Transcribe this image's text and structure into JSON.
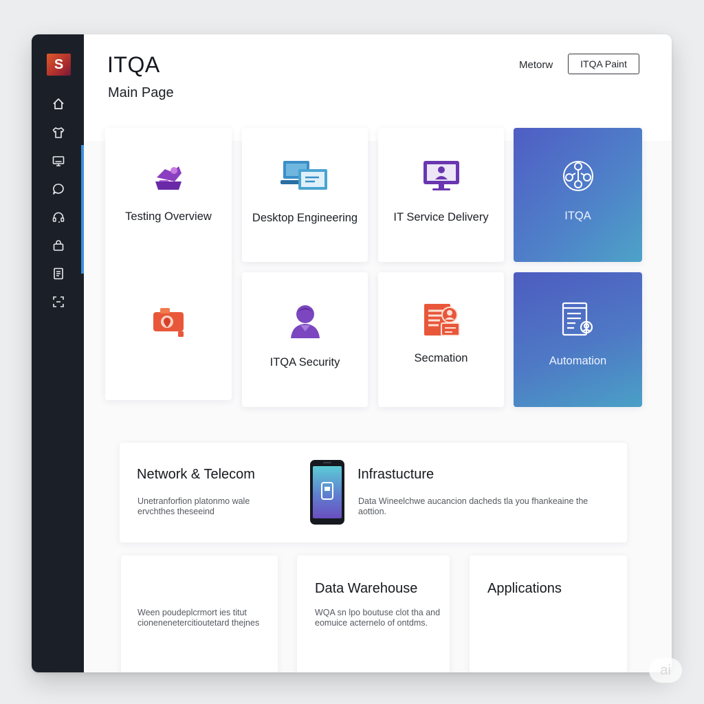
{
  "sidebar": {
    "logo_text": "S",
    "items": [
      {
        "icon": "home-icon"
      },
      {
        "icon": "shirt-icon"
      },
      {
        "icon": "monitor-icon"
      },
      {
        "icon": "chat-icon"
      },
      {
        "icon": "headset-icon"
      },
      {
        "icon": "bag-icon"
      },
      {
        "icon": "document-icon"
      },
      {
        "icon": "scan-icon"
      }
    ]
  },
  "header": {
    "title": "ITQA",
    "subtitle": "Main Page",
    "link_label": "Metorw",
    "button_label": "ITQA Paint"
  },
  "tiles": [
    {
      "label": "Testing Overview",
      "icon": "handshake-icon"
    },
    {
      "label": "Desktop Engineering",
      "icon": "desktops-icon"
    },
    {
      "label": "IT Service Delivery",
      "icon": "monitor-user-icon"
    },
    {
      "label": "ITQA",
      "icon": "team-network-icon"
    },
    {
      "label": "",
      "icon": "camera-location-icon"
    },
    {
      "label": "ITQA Security",
      "icon": "user-icon"
    },
    {
      "label": "Secmation",
      "icon": "form-user-icon"
    },
    {
      "label": "Automation",
      "icon": "report-user-icon"
    }
  ],
  "cards": {
    "network": {
      "title": "Network & Telecom",
      "body": "Unetranforfion platonmo wale ervchthes theseeind"
    },
    "infrastructure": {
      "title": "Infrastucture",
      "body": "Data Wineelchwe aucancion dacheds tla you fhankeaine the aottion.",
      "icon": "smartphone-icon"
    },
    "left_bottom": {
      "body": "Ween poudeplcrmort ies titut cionenenetercitioutetard thejnes"
    },
    "data_warehouse": {
      "title": "Data Warehouse",
      "body": "WQA sn lpo boutuse clot tha and eomuice acternelo of ontdms."
    },
    "applications": {
      "title": "Applications"
    }
  },
  "badge": "ai",
  "colors": {
    "sidebar_bg": "#1b2028",
    "accent_blue": "#4f6fc6",
    "purple": "#7b3fb3",
    "orange": "#e8573a"
  }
}
